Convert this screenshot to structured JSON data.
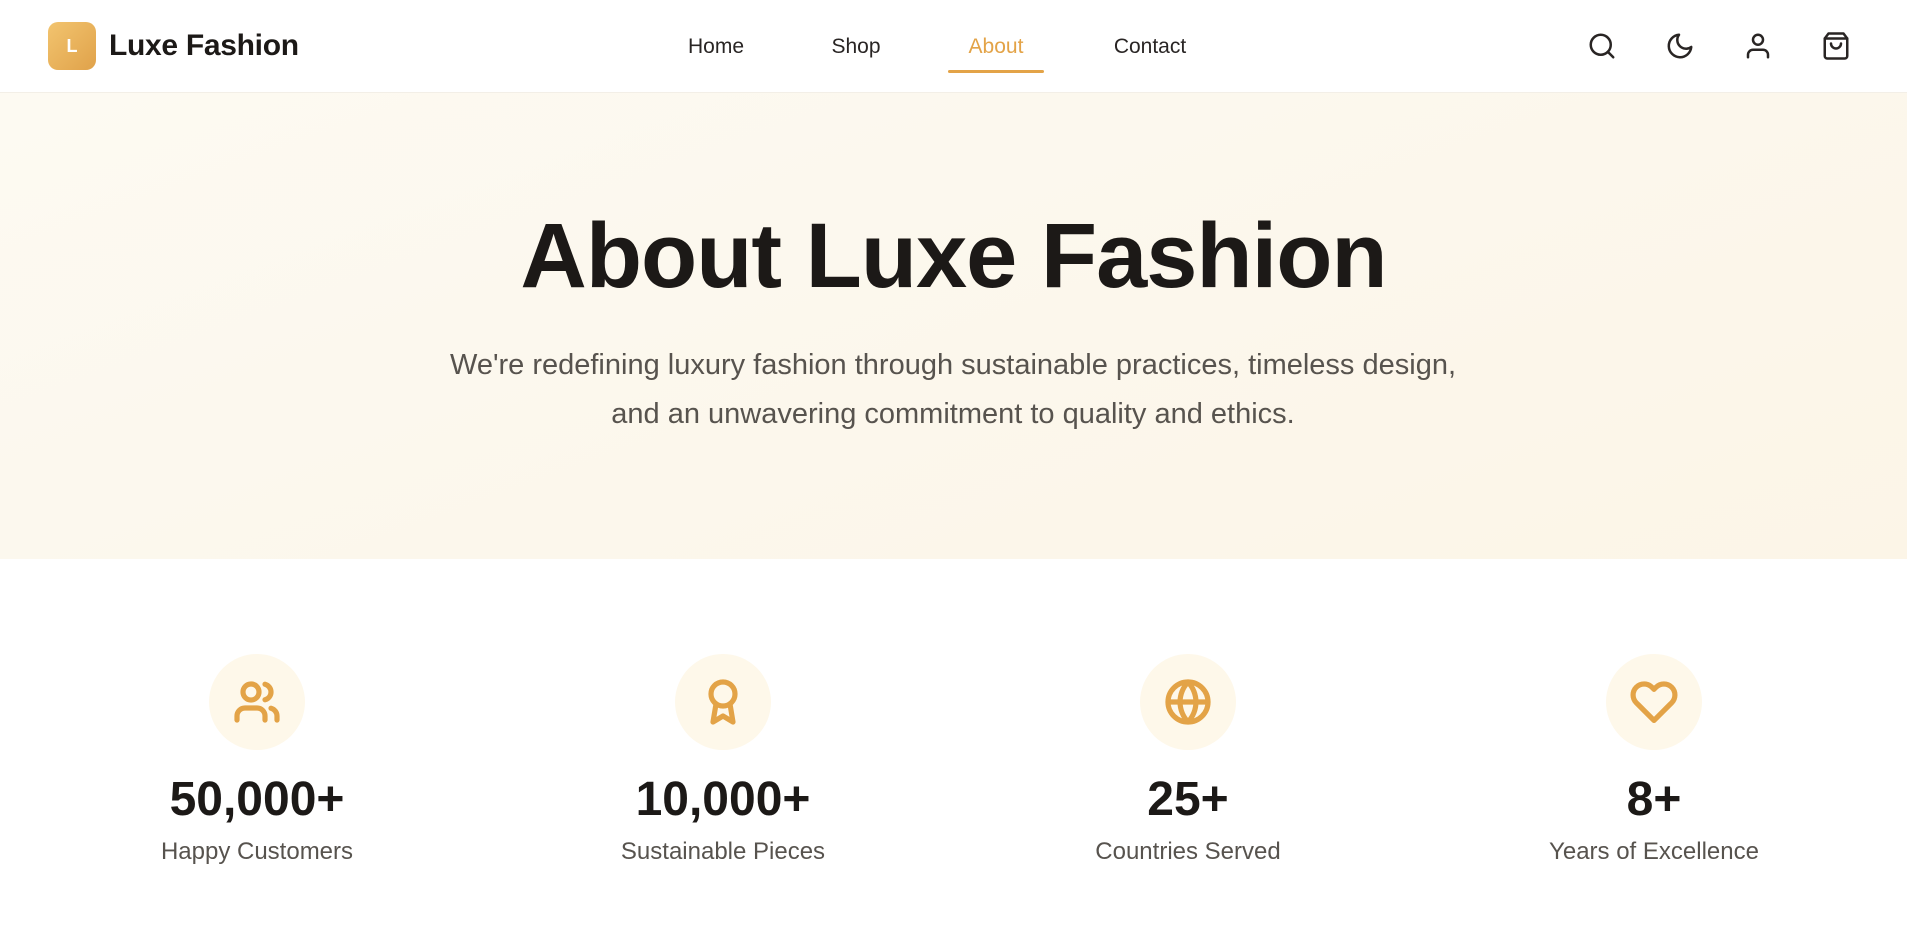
{
  "brand": {
    "mark": "L",
    "name": "Luxe Fashion"
  },
  "nav": {
    "items": [
      {
        "label": "Home",
        "active": false
      },
      {
        "label": "Shop",
        "active": false
      },
      {
        "label": "About",
        "active": true
      },
      {
        "label": "Contact",
        "active": false
      }
    ]
  },
  "header_icons": [
    "search-icon",
    "moon-icon",
    "user-icon",
    "shopping-bag-icon"
  ],
  "hero": {
    "title": "About Luxe Fashion",
    "subtitle_line1": "We're redefining luxury fashion through sustainable practices, timeless design,",
    "subtitle_line2": "and an unwavering commitment to quality and ethics."
  },
  "stats": [
    {
      "icon": "users-icon",
      "value": "50,000+",
      "label": "Happy Customers"
    },
    {
      "icon": "award-icon",
      "value": "10,000+",
      "label": "Sustainable Pieces"
    },
    {
      "icon": "globe-icon",
      "value": "25+",
      "label": "Countries Served"
    },
    {
      "icon": "heart-icon",
      "value": "8+",
      "label": "Years of Excellence"
    }
  ],
  "colors": {
    "accent": "#e3a347",
    "text": "#1c1917",
    "muted": "#57534e",
    "hero_bg": "#fcf7ec"
  }
}
